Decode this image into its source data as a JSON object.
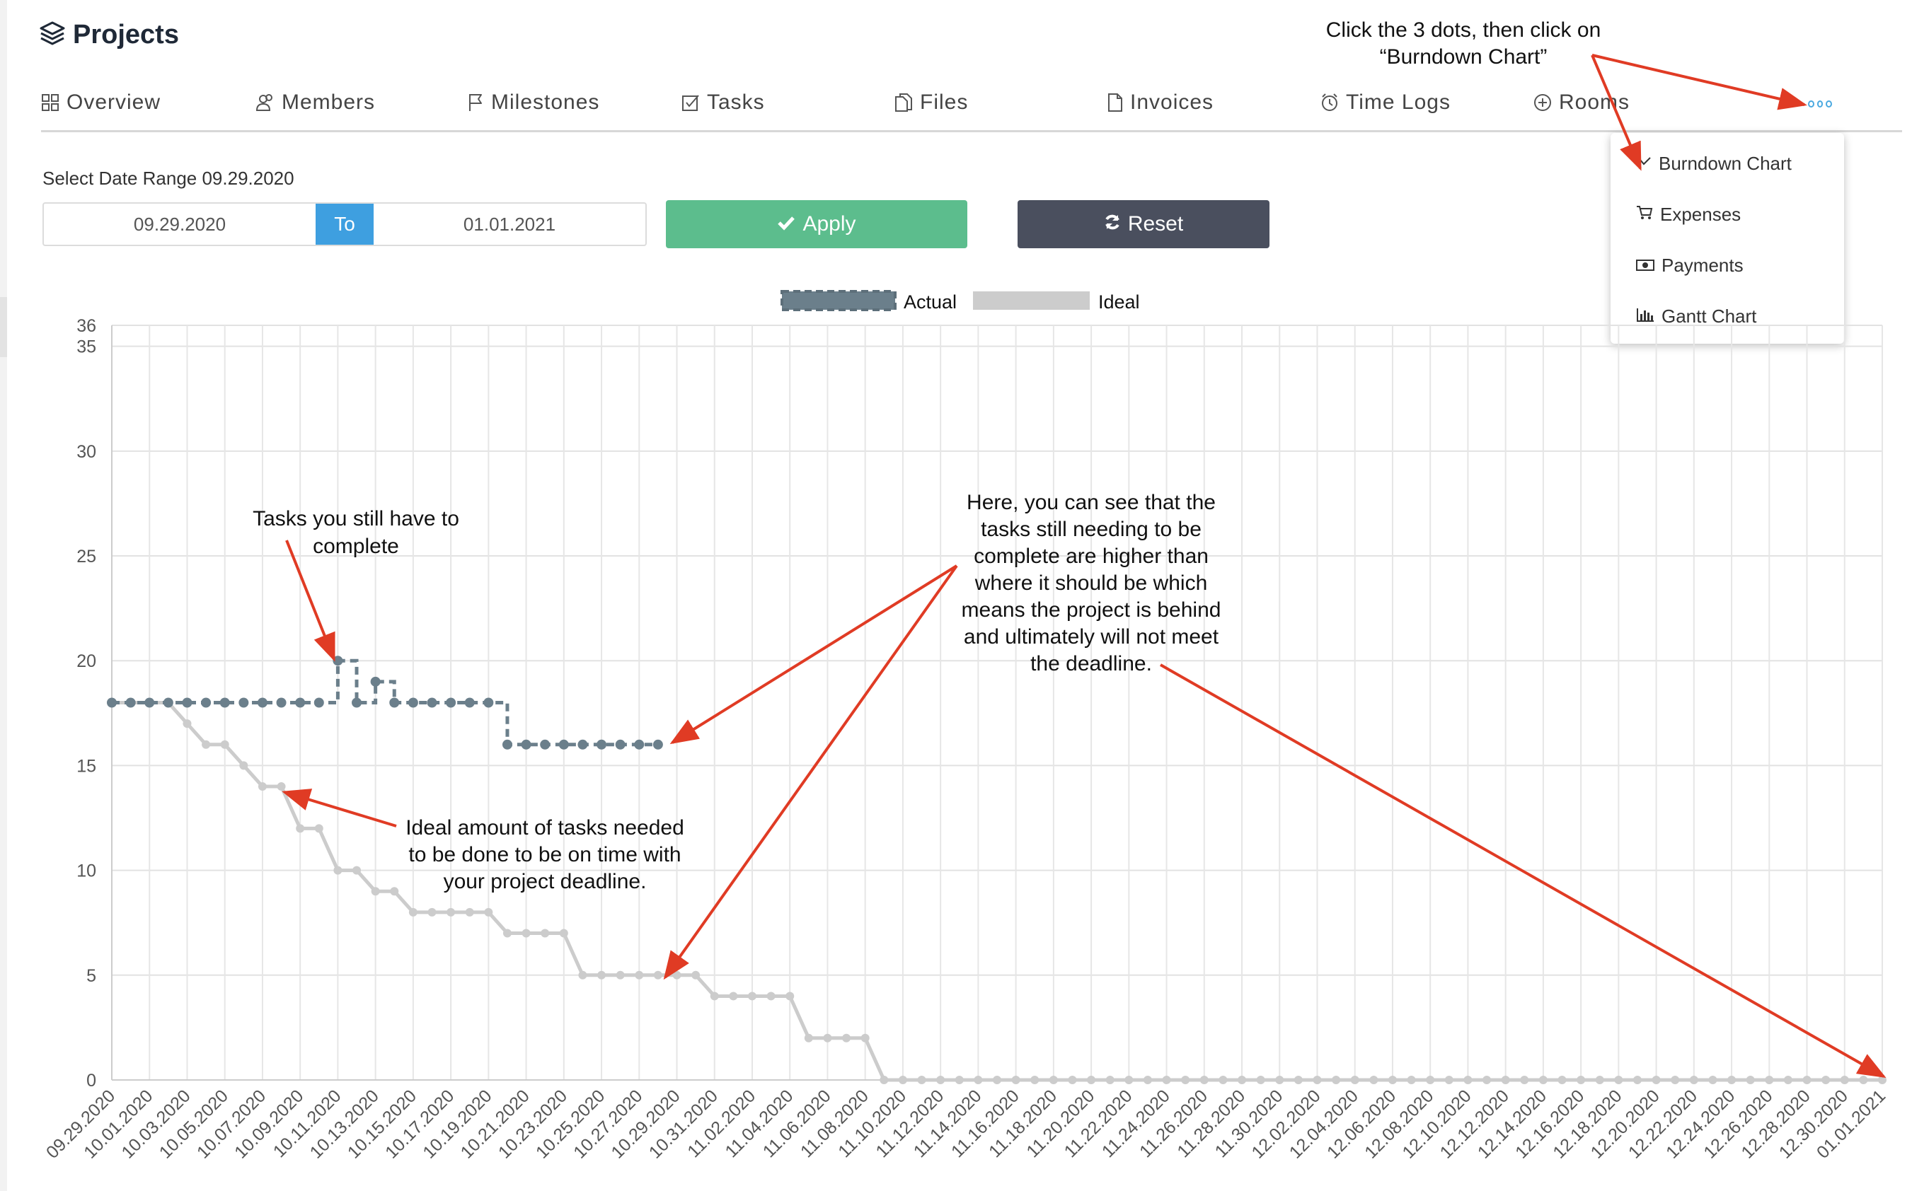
{
  "header": {
    "title": "Projects"
  },
  "tabs": [
    {
      "label": "Overview",
      "icon": "grid-icon"
    },
    {
      "label": "Members",
      "icon": "users-icon"
    },
    {
      "label": "Milestones",
      "icon": "flag-icon"
    },
    {
      "label": "Tasks",
      "icon": "checkbox-icon"
    },
    {
      "label": "Files",
      "icon": "files-icon"
    },
    {
      "label": "Invoices",
      "icon": "document-icon"
    },
    {
      "label": "Time Logs",
      "icon": "alarm-clock-icon"
    },
    {
      "label": "Rooms",
      "icon": "plus-circle-icon"
    }
  ],
  "more_menu": {
    "icon": "more-dots-icon",
    "items": [
      {
        "label": "Burndown Chart",
        "icon": "line-chart-icon"
      },
      {
        "label": "Expenses",
        "icon": "cart-icon"
      },
      {
        "label": "Payments",
        "icon": "money-icon"
      },
      {
        "label": "Gantt Chart",
        "icon": "bar-chart-icon"
      }
    ]
  },
  "filters": {
    "range_label": "Select Date Range 09.29.2020",
    "from_date": "09.29.2020",
    "to_label": "To",
    "to_date": "01.01.2021",
    "apply_label": "Apply",
    "reset_label": "Reset"
  },
  "colors": {
    "actual": "#6b7f8b",
    "ideal": "#cccccc",
    "apply": "#5cbd8d",
    "reset": "#4a4f5e",
    "to": "#3e9fe0",
    "annotation_arrow": "#e03b24"
  },
  "annotations": {
    "top_instruction": [
      "Click the 3 dots, then click on",
      "“Burndown Chart”"
    ],
    "tasks_left": [
      "Tasks you still have to",
      "complete"
    ],
    "behind": [
      "Here, you can see that the",
      "tasks still needing to be",
      "complete are higher than",
      "where it should be which",
      "means the project is behind",
      "and ultimately will not meet",
      "the deadline."
    ],
    "ideal_note": [
      "Ideal amount of tasks needed",
      "to be done to be on time with",
      "your project deadline."
    ]
  },
  "chart_data": {
    "type": "line",
    "title": "",
    "xlabel": "",
    "ylabel": "",
    "ylim": [
      0,
      36
    ],
    "yticks": [
      0,
      5,
      10,
      15,
      20,
      25,
      30,
      35,
      36
    ],
    "grid": true,
    "legend_position": "top-center",
    "x_labels": [
      "09.29.2020",
      "10.01.2020",
      "10.03.2020",
      "10.05.2020",
      "10.07.2020",
      "10.09.2020",
      "10.11.2020",
      "10.13.2020",
      "10.15.2020",
      "10.17.2020",
      "10.19.2020",
      "10.21.2020",
      "10.23.2020",
      "10.25.2020",
      "10.27.2020",
      "10.29.2020",
      "10.31.2020",
      "11.02.2020",
      "11.04.2020",
      "11.06.2020",
      "11.08.2020",
      "11.10.2020",
      "11.12.2020",
      "11.14.2020",
      "11.16.2020",
      "11.18.2020",
      "11.20.2020",
      "11.22.2020",
      "11.24.2020",
      "11.26.2020",
      "11.28.2020",
      "11.30.2020",
      "12.02.2020",
      "12.04.2020",
      "12.06.2020",
      "12.08.2020",
      "12.10.2020",
      "12.12.2020",
      "12.14.2020",
      "12.16.2020",
      "12.18.2020",
      "12.20.2020",
      "12.22.2020",
      "12.24.2020",
      "12.26.2020",
      "12.28.2020",
      "12.30.2020",
      "01.01.2021"
    ],
    "series": [
      {
        "name": "Actual",
        "style": "dashed-step",
        "values": [
          18,
          18,
          18,
          18,
          18,
          18,
          18,
          18,
          18,
          18,
          18,
          18,
          20,
          18,
          19,
          18,
          18,
          18,
          18,
          18,
          18,
          16,
          16,
          16,
          16,
          16,
          16,
          16,
          16,
          16
        ]
      },
      {
        "name": "Ideal",
        "style": "solid",
        "values": [
          18,
          18,
          18,
          18,
          17,
          16,
          16,
          15,
          14,
          14,
          12,
          12,
          10,
          10,
          9,
          9,
          8,
          8,
          8,
          8,
          8,
          7,
          7,
          7,
          7,
          5,
          5,
          5,
          5,
          5,
          5,
          5,
          4,
          4,
          4,
          4,
          4,
          2,
          2,
          2,
          2,
          0,
          0,
          0,
          0,
          0,
          0,
          0,
          0,
          0,
          0,
          0,
          0,
          0,
          0,
          0,
          0,
          0,
          0,
          0,
          0,
          0,
          0,
          0,
          0,
          0,
          0,
          0,
          0,
          0,
          0,
          0,
          0,
          0,
          0,
          0,
          0,
          0,
          0,
          0,
          0,
          0,
          0,
          0,
          0,
          0,
          0,
          0,
          0,
          0,
          0,
          0,
          0,
          0,
          0
        ]
      }
    ]
  }
}
